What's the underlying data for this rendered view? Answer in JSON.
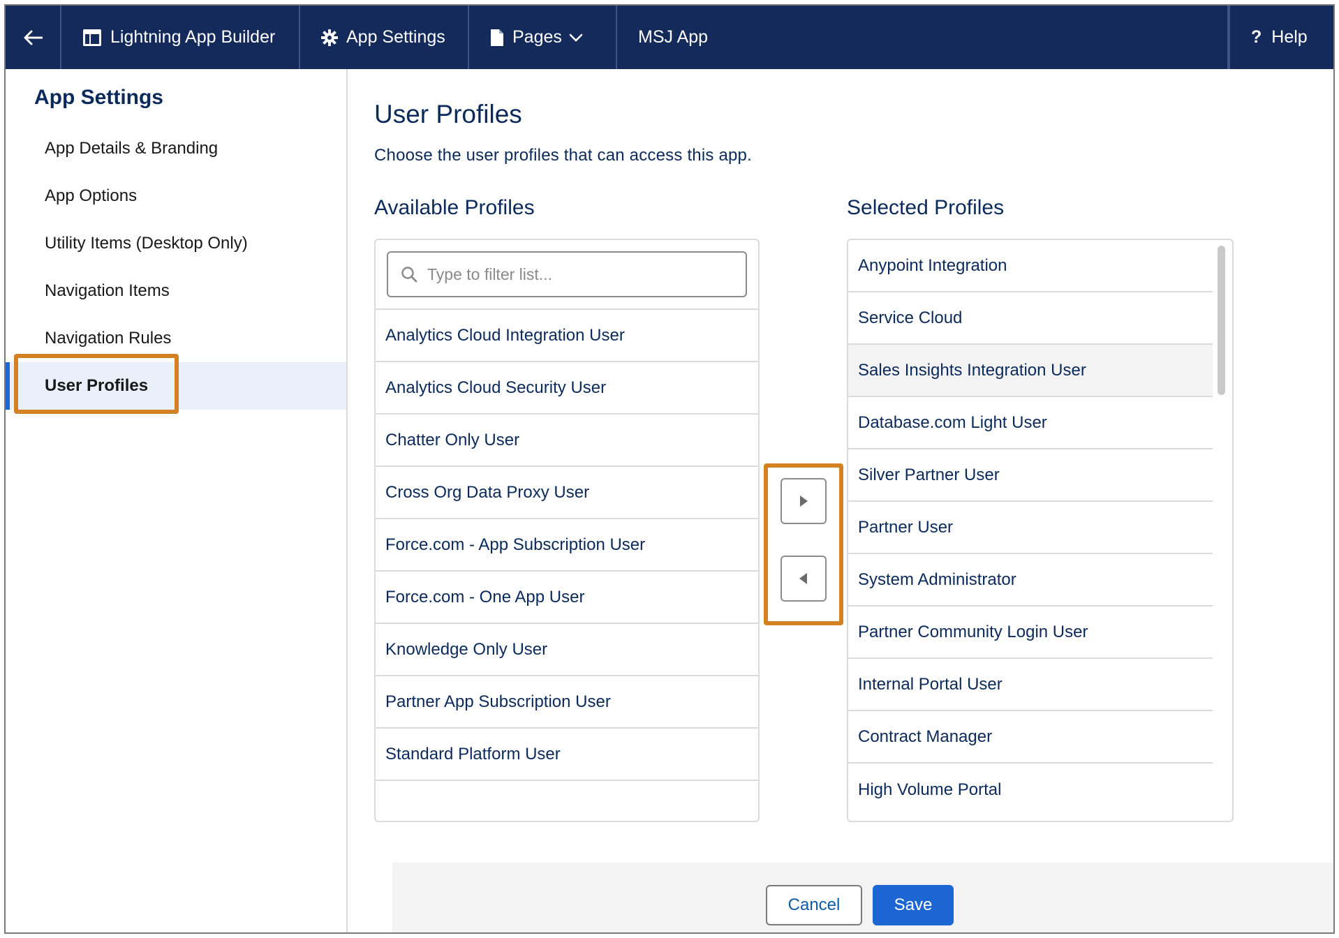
{
  "topbar": {
    "builder_label": "Lightning App Builder",
    "settings_label": "App Settings",
    "pages_label": "Pages",
    "app_name": "MSJ App",
    "help_label": "Help"
  },
  "sidebar": {
    "title": "App Settings",
    "items": [
      {
        "label": "App Details & Branding"
      },
      {
        "label": "App Options"
      },
      {
        "label": "Utility Items (Desktop Only)"
      },
      {
        "label": "Navigation Items"
      },
      {
        "label": "Navigation Rules"
      },
      {
        "label": "User Profiles",
        "active": true
      }
    ]
  },
  "main": {
    "title": "User Profiles",
    "description": "Choose the user profiles that can access this app.",
    "available": {
      "title": "Available Profiles",
      "filter_placeholder": "Type to filter list...",
      "items": [
        "Analytics Cloud Integration User",
        "Analytics Cloud Security User",
        "Chatter Only User",
        "Cross Org Data Proxy User",
        "Force.com - App Subscription User",
        "Force.com - One App User",
        "Knowledge Only User",
        "Partner App Subscription User",
        "Standard Platform User"
      ]
    },
    "selected": {
      "title": "Selected Profiles",
      "items": [
        "Anypoint Integration",
        "Service Cloud",
        "Sales Insights Integration User",
        "Database.com Light User",
        "Silver Partner User",
        "Partner User",
        "System Administrator",
        "Partner Community Login User",
        "Internal Portal User",
        "Contract Manager",
        "High Volume Portal"
      ],
      "highlighted": "Sales Insights Integration User"
    },
    "move_right_icon": "triangle-right-icon",
    "move_left_icon": "triangle-left-icon"
  },
  "footer": {
    "cancel_label": "Cancel",
    "save_label": "Save"
  },
  "colors": {
    "header_bg": "#132a5a",
    "highlight_outline": "#d38122",
    "brand_blue": "#1b66d2",
    "title_navy": "#0b2a5c"
  }
}
